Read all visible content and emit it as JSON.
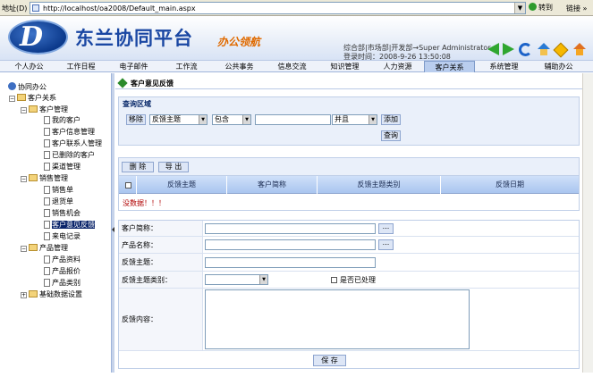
{
  "browser": {
    "address_label": "地址(D)",
    "url": "http://localhost/oa2008/Default_main.aspx",
    "go_label": "转到",
    "links_label": "链接 »"
  },
  "header": {
    "logo_letter": "D",
    "brand_name": "东兰协同平台",
    "brand_tag": "办公领航",
    "dept_line": "综合部|市场部|开发部→Super Administrator",
    "login_line": "登录时间：2008-9-26 13:50:08"
  },
  "toolbar_icons": [
    "back-arrow-icon",
    "forward-arrow-icon",
    "refresh-icon",
    "home-icon",
    "info-icon",
    "exit-icon"
  ],
  "nav": {
    "items": [
      "个人办公",
      "工作日程",
      "电子邮件",
      "工作流",
      "公共事务",
      "信息交流",
      "知识管理",
      "人力资源",
      "客户关系",
      "系统管理",
      "辅助办公"
    ],
    "active_index": 8
  },
  "sidebar": {
    "root": "协同办公",
    "crm": "客户关系",
    "customer_mgmt": "客户管理",
    "my_customers": "我的客户",
    "customer_info": "客户信息管理",
    "contact_mgmt": "客户联系人管理",
    "deleted_customers": "已删除的客户",
    "channel_mgmt": "渠道管理",
    "sales_mgmt": "销售管理",
    "sales_orders": "销售单",
    "return_orders": "退货单",
    "sales_opportunity": "销售机会",
    "customer_feedback": "客户意见反馈",
    "visit_records": "来电记录",
    "product_mgmt": "产品管理",
    "product_info": "产品资料",
    "product_quote": "产品报价",
    "product_category": "产品类别",
    "base_data": "基础数据设置"
  },
  "main": {
    "page_title": "客户意见反馈",
    "query": {
      "title": "查询区域",
      "remove_label": "移除",
      "field_value": "反馈主题",
      "operator_value": "包含",
      "keyword_value": "",
      "logic_value": "并且",
      "add_label": "添加",
      "search_label": "查询"
    },
    "results": {
      "delete_label": "删 除",
      "export_label": "导 出",
      "columns": [
        "反馈主题",
        "客户简称",
        "反馈主题类别",
        "反馈日期"
      ],
      "no_data": "没数据！！！"
    },
    "form": {
      "customer_label": "客户简称：",
      "product_label": "产品名称：",
      "subject_label": "反馈主题：",
      "category_label": "反馈主题类别：",
      "processed_label": "是否已处理",
      "content_label": "反馈内容：",
      "customer_value": "",
      "product_value": "",
      "subject_value": "",
      "category_value": "",
      "content_value": "",
      "ellipsis_label": "...",
      "save_label": "保 存"
    }
  }
}
